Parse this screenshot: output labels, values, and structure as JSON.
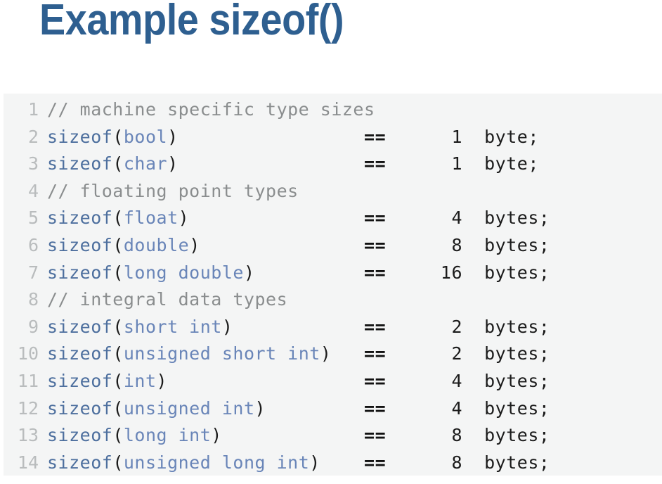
{
  "slide": {
    "title": "Example sizeof()",
    "title_color": "#2e5f90",
    "background_color": "#ffffff"
  },
  "code_block": {
    "background_color": "#f4f5f5",
    "line_number_color": "#b9bcbd",
    "comment_color": "#8a8d8e",
    "function_color": "#4d6f9e",
    "type_color": "#6985b8",
    "punctuation_color": "#1b1b1b",
    "language": "cpp",
    "line_count": 14,
    "lines": [
      {
        "number": "1",
        "kind": "comment",
        "comment": "// machine specific type sizes"
      },
      {
        "number": "2",
        "kind": "code",
        "fn": "sizeof",
        "open": "(",
        "type": "bool",
        "close": ")",
        "pad_after_close": "                 ",
        "op": "==",
        "pad_after_op": "     ",
        "size": " 1",
        "gap": "  ",
        "unit": "byte;"
      },
      {
        "number": "3",
        "kind": "code",
        "fn": "sizeof",
        "open": "(",
        "type": "char",
        "close": ")",
        "pad_after_close": "                 ",
        "op": "==",
        "pad_after_op": "     ",
        "size": " 1",
        "gap": "  ",
        "unit": "byte;"
      },
      {
        "number": "4",
        "kind": "comment",
        "comment": "// floating point types"
      },
      {
        "number": "5",
        "kind": "code",
        "fn": "sizeof",
        "open": "(",
        "type": "float",
        "close": ")",
        "pad_after_close": "                ",
        "op": "==",
        "pad_after_op": "     ",
        "size": " 4",
        "gap": "  ",
        "unit": "bytes;"
      },
      {
        "number": "6",
        "kind": "code",
        "fn": "sizeof",
        "open": "(",
        "type": "double",
        "close": ")",
        "pad_after_close": "               ",
        "op": "==",
        "pad_after_op": "     ",
        "size": " 8",
        "gap": "  ",
        "unit": "bytes;"
      },
      {
        "number": "7",
        "kind": "code",
        "fn": "sizeof",
        "open": "(",
        "type": "long double",
        "close": ")",
        "pad_after_close": "          ",
        "op": "==",
        "pad_after_op": "     ",
        "size": "16",
        "gap": "  ",
        "unit": "bytes;"
      },
      {
        "number": "8",
        "kind": "comment",
        "comment": "// integral data types"
      },
      {
        "number": "9",
        "kind": "code",
        "fn": "sizeof",
        "open": "(",
        "type": "short int",
        "close": ")",
        "pad_after_close": "            ",
        "op": "==",
        "pad_after_op": "     ",
        "size": " 2",
        "gap": "  ",
        "unit": "bytes;"
      },
      {
        "number": "10",
        "kind": "code",
        "fn": "sizeof",
        "open": "(",
        "type": "unsigned short int",
        "close": ")",
        "pad_after_close": "   ",
        "op": "==",
        "pad_after_op": "     ",
        "size": " 2",
        "gap": "  ",
        "unit": "bytes;"
      },
      {
        "number": "11",
        "kind": "code",
        "fn": "sizeof",
        "open": "(",
        "type": "int",
        "close": ")",
        "pad_after_close": "                  ",
        "op": "==",
        "pad_after_op": "     ",
        "size": " 4",
        "gap": "  ",
        "unit": "bytes;"
      },
      {
        "number": "12",
        "kind": "code",
        "fn": "sizeof",
        "open": "(",
        "type": "unsigned int",
        "close": ")",
        "pad_after_close": "         ",
        "op": "==",
        "pad_after_op": "     ",
        "size": " 4",
        "gap": "  ",
        "unit": "bytes;"
      },
      {
        "number": "13",
        "kind": "code",
        "fn": "sizeof",
        "open": "(",
        "type": "long int",
        "close": ")",
        "pad_after_close": "             ",
        "op": "==",
        "pad_after_op": "     ",
        "size": " 8",
        "gap": "  ",
        "unit": "bytes;"
      },
      {
        "number": "14",
        "kind": "code",
        "fn": "sizeof",
        "open": "(",
        "type": "unsigned long int",
        "close": ")",
        "pad_after_close": "    ",
        "op": "==",
        "pad_after_op": "     ",
        "size": " 8",
        "gap": "  ",
        "unit": "bytes;"
      }
    ]
  }
}
